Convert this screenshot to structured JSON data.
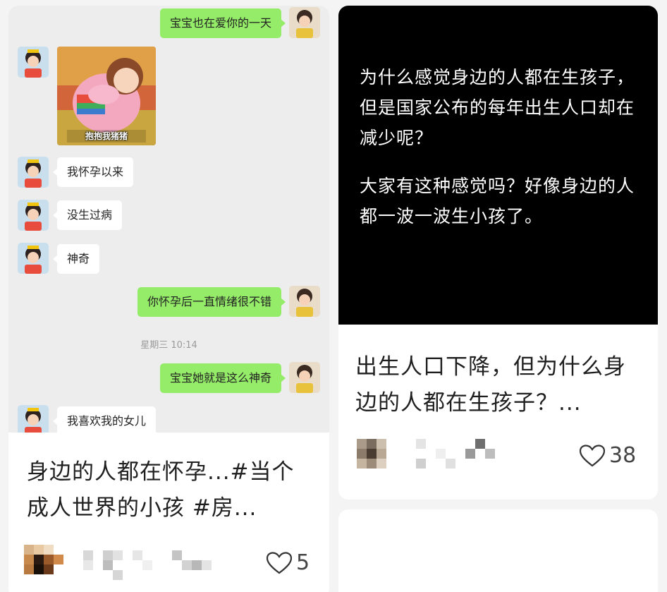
{
  "left_card": {
    "chat": {
      "messages": [
        {
          "side": "me",
          "text": "宝宝也在爱你的一天"
        },
        {
          "side": "other",
          "text": "我怀孕以来"
        },
        {
          "side": "other",
          "text": "没生过病"
        },
        {
          "side": "other",
          "text": "神奇"
        },
        {
          "side": "me",
          "text": "你怀孕后一直情绪很不错"
        },
        {
          "side": "me",
          "text": "宝宝她就是这么神奇"
        },
        {
          "side": "other",
          "text": "我喜欢我的女儿"
        }
      ],
      "timestamp": "星期三 10:14",
      "sticker_caption": "抱抱我猪猪"
    },
    "title": "身边的人都在怀孕...#当个成人世界的小孩 #房...",
    "likes": "5"
  },
  "right_card": {
    "image_text_1": "为什么感觉身边的人都在生孩子，但是国家公布的每年出生人口却在减少呢？",
    "image_text_2": "大家有这种感觉吗？好像身边的人都一波一波生小孩了。",
    "title": "出生人口下降，但为什么身边的人都在生孩子？...",
    "likes": "38"
  },
  "colors": {
    "my_bubble": "#95ec69",
    "chat_bg": "#ededed",
    "like_heart": "#333333"
  },
  "icons": {
    "like": "heart-outline-icon"
  }
}
